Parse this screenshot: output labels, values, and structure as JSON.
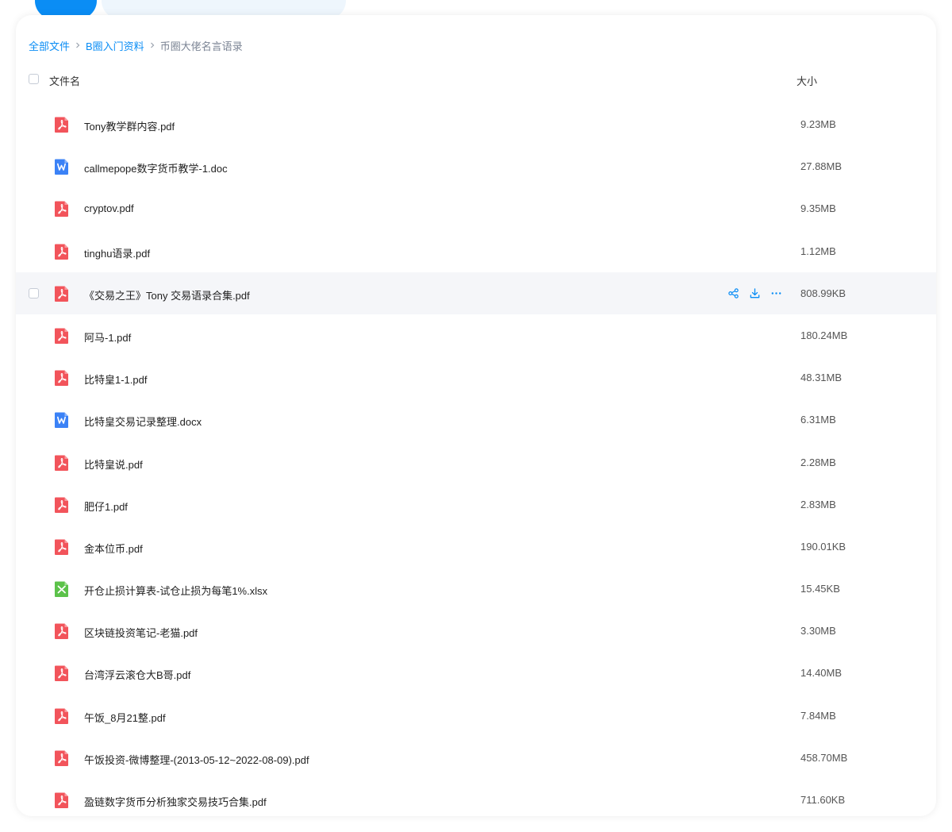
{
  "breadcrumb": {
    "items": [
      "全部文件",
      "B圈入门资料",
      "币圈大佬名言语录"
    ]
  },
  "table": {
    "headers": {
      "name": "文件名",
      "size": "大小"
    },
    "rows": [
      {
        "name": "Tony教学群内容.pdf",
        "size": "9.23MB",
        "type": "pdf"
      },
      {
        "name": "callmepope数字货币教学-1.doc",
        "size": "27.88MB",
        "type": "word"
      },
      {
        "name": "cryptov.pdf",
        "size": "9.35MB",
        "type": "pdf"
      },
      {
        "name": "tinghu语录.pdf",
        "size": "1.12MB",
        "type": "pdf"
      },
      {
        "name": "《交易之王》Tony 交易语录合集.pdf",
        "size": "808.99KB",
        "type": "pdf",
        "hovered": true
      },
      {
        "name": "阿马-1.pdf",
        "size": "180.24MB",
        "type": "pdf"
      },
      {
        "name": "比特皇1-1.pdf",
        "size": "48.31MB",
        "type": "pdf"
      },
      {
        "name": "比特皇交易记录整理.docx",
        "size": "6.31MB",
        "type": "word"
      },
      {
        "name": "比特皇说.pdf",
        "size": "2.28MB",
        "type": "pdf"
      },
      {
        "name": "肥仔1.pdf",
        "size": "2.83MB",
        "type": "pdf"
      },
      {
        "name": "金本位币.pdf",
        "size": "190.01KB",
        "type": "pdf"
      },
      {
        "name": "开仓止损计算表-试仓止损为每笔1%.xlsx",
        "size": "15.45KB",
        "type": "excel"
      },
      {
        "name": "区块链投资笔记-老猫.pdf",
        "size": "3.30MB",
        "type": "pdf"
      },
      {
        "name": "台湾浮云滚仓大B哥.pdf",
        "size": "14.40MB",
        "type": "pdf"
      },
      {
        "name": "午饭_8月21整.pdf",
        "size": "7.84MB",
        "type": "pdf"
      },
      {
        "name": "午饭投资-微博整理-(2013-05-12~2022-08-09).pdf",
        "size": "458.70MB",
        "type": "pdf"
      },
      {
        "name": "盈链数字货币分析独家交易技巧合集.pdf",
        "size": "711.60KB",
        "type": "pdf"
      }
    ]
  },
  "row_actions": [
    "share-icon",
    "download-icon",
    "more-icon"
  ],
  "icons": {
    "pdf": "pdf-file-icon",
    "word": "word-file-icon",
    "excel": "excel-file-icon"
  },
  "colors": {
    "accent": "#0a8df5",
    "pdf": "#f2545b",
    "word": "#3b82f6",
    "excel": "#5cc24a",
    "hover_row": "#f5f6f9"
  }
}
